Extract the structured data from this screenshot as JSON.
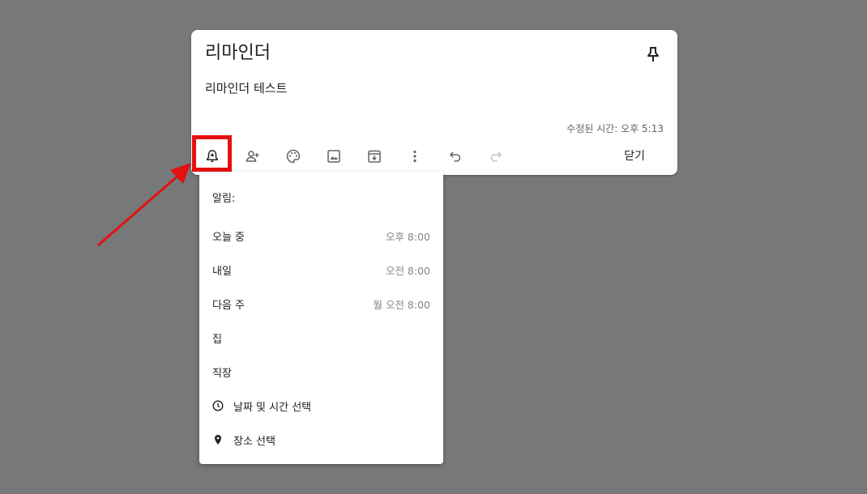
{
  "note": {
    "title": "리마인더",
    "body": "리마인더 테스트",
    "edited": "수정된 시간: 오후 5:13",
    "close_label": "닫기"
  },
  "toolbar": {
    "icons": [
      "reminder-icon",
      "collaborator-icon",
      "palette-icon",
      "image-icon",
      "archive-icon",
      "more-icon",
      "undo-icon",
      "redo-icon"
    ]
  },
  "menu": {
    "header": "알림:",
    "items": [
      {
        "label": "오늘 중",
        "time": "오후 8:00"
      },
      {
        "label": "내일",
        "time": "오전 8:00"
      },
      {
        "label": "다음 주",
        "time": "월 오전 8:00"
      },
      {
        "label": "집",
        "time": ""
      },
      {
        "label": "직장",
        "time": ""
      }
    ],
    "pick_date": "날짜 및 시간 선택",
    "pick_place": "장소 선택"
  },
  "colors": {
    "overlay": "#77787a",
    "highlight": "#e3110f",
    "arrow": "#e3110f"
  }
}
